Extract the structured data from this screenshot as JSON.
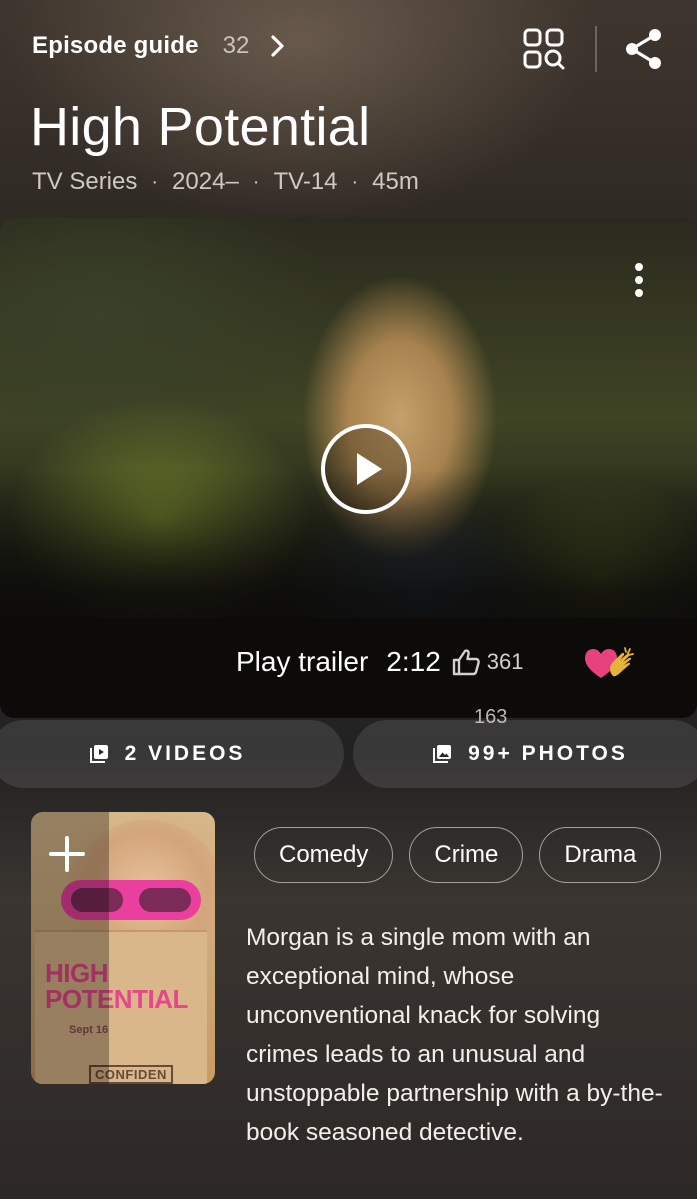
{
  "header": {
    "episode_guide_label": "Episode guide",
    "episode_count": "32"
  },
  "title": "High Potential",
  "meta": {
    "type": "TV Series",
    "years": "2024–",
    "rating": "TV-14",
    "runtime": "45m"
  },
  "trailer": {
    "label": "Play trailer",
    "duration": "2:12",
    "likes": "361",
    "reaction_count": "163"
  },
  "media_buttons": {
    "videos_label": "2 VIDEOS",
    "photos_label": "99+ PHOTOS"
  },
  "poster": {
    "title_line1": "HIGH",
    "title_line2": "POTENTIAL",
    "date": "Sept 16",
    "stamp": "CONFIDEN"
  },
  "genres": [
    "Comedy",
    "Crime",
    "Drama"
  ],
  "plot": "Morgan is a single mom with an exceptional mind, whose unconventional knack for solving crimes leads to an unusual and unstoppable partnership with a by-the-book seasoned detective.",
  "colors": {
    "heart": "#e8427e",
    "clap": "#e3b33c",
    "poster_title": "#e8468b"
  },
  "icons": {
    "episode_chevron": "chevron-right-icon",
    "browse": "grid-search-icon",
    "share": "share-icon",
    "more": "more-vertical-icon",
    "play": "play-circle-icon",
    "like": "thumb-up-icon",
    "videos": "video-library-icon",
    "photos": "photo-library-icon",
    "add": "plus-icon"
  }
}
